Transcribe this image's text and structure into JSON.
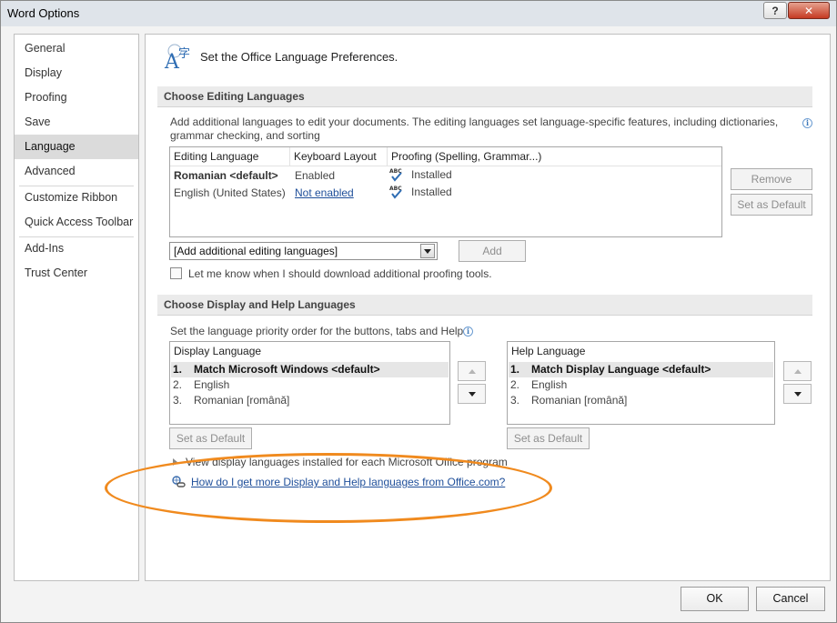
{
  "window": {
    "title": "Word Options",
    "help_glyph": "?",
    "close_glyph": "✕"
  },
  "nav": {
    "items": [
      {
        "label": "General"
      },
      {
        "label": "Display"
      },
      {
        "label": "Proofing"
      },
      {
        "label": "Save"
      },
      {
        "label": "Language",
        "selected": true
      },
      {
        "label": "Advanced"
      },
      {
        "label": "Customize Ribbon"
      },
      {
        "label": "Quick Access Toolbar"
      },
      {
        "label": "Add-Ins"
      },
      {
        "label": "Trust Center"
      }
    ]
  },
  "header": {
    "icon": "language-icon",
    "text": "Set the Office Language Preferences."
  },
  "editing": {
    "section_title": "Choose Editing Languages",
    "description_line1": "Add additional languages to edit your documents. The editing languages set language-specific features, including dictionaries,",
    "description_line2": "grammar checking, and sorting",
    "columns": [
      "Editing Language",
      "Keyboard Layout",
      "Proofing (Spelling, Grammar...)"
    ],
    "rows": [
      {
        "language": "Romanian <default>",
        "keyboard": "Enabled",
        "proofing": "Installed"
      },
      {
        "language": "English (United States)",
        "keyboard": "Not enabled",
        "proofing": "Installed"
      }
    ],
    "remove_label": "Remove",
    "set_default_label": "Set as Default",
    "add_combo_value": "[Add additional editing languages]",
    "add_label": "Add",
    "checkbox_label": "Let me know when I should download additional proofing tools.",
    "checkbox_checked": false
  },
  "display_help": {
    "section_title": "Choose Display and Help Languages",
    "description": "Set the language priority order for the buttons, tabs and Help",
    "display_list": {
      "header": "Display Language",
      "items": [
        {
          "num": "1.",
          "label": "Match Microsoft Windows <default>"
        },
        {
          "num": "2.",
          "label": "English"
        },
        {
          "num": "3.",
          "label": "Romanian [română]"
        }
      ]
    },
    "help_list": {
      "header": "Help Language",
      "items": [
        {
          "num": "1.",
          "label": "Match Display Language <default>"
        },
        {
          "num": "2.",
          "label": "English"
        },
        {
          "num": "3.",
          "label": "Romanian [română]"
        }
      ]
    },
    "set_default_label": "Set as Default",
    "expander_label": "View display languages installed for each Microsoft Office program",
    "more_link": "How do I get more Display and Help languages from Office.com?"
  },
  "footer": {
    "ok_label": "OK",
    "cancel_label": "Cancel"
  },
  "colors": {
    "highlight_oval": "#f08a1e",
    "link": "#1f4f9a",
    "selected_nav": "#dbdbdb"
  }
}
